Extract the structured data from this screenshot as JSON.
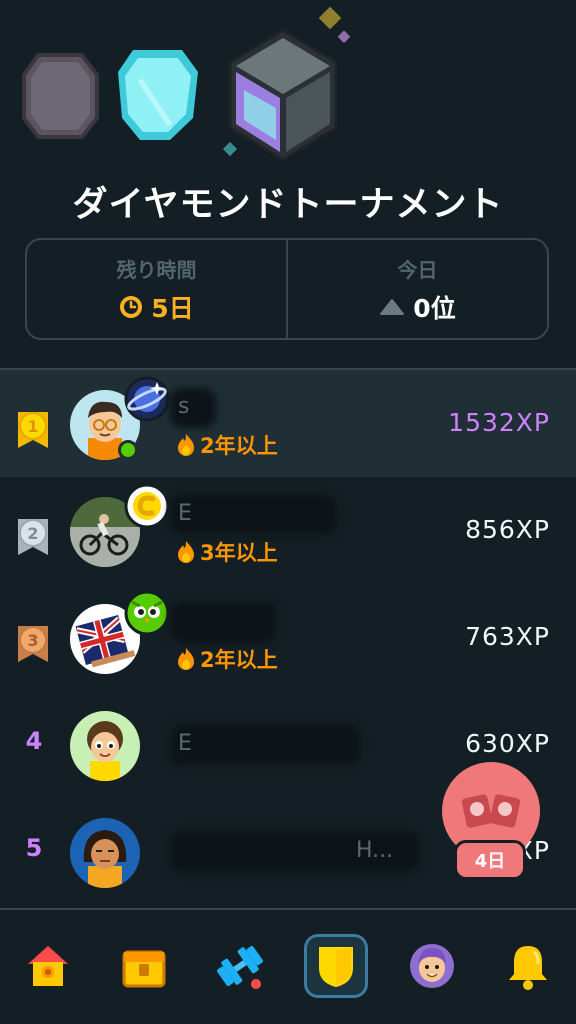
{
  "league": {
    "title": "ダイヤモンドトーナメント",
    "gems": [
      "obsidian-gem-icon",
      "diamond-gem-icon",
      "locked-gem-icon"
    ]
  },
  "stats": {
    "time_left": {
      "label": "残り時間",
      "value": "5日",
      "icon": "clock-icon"
    },
    "today": {
      "label": "今日",
      "value": "0位",
      "icon": "triangle-up-icon"
    }
  },
  "leaderboard": [
    {
      "rank": "1",
      "badge": "gold-medal-icon",
      "name": "s",
      "streak": "2年以上",
      "xp": "1532XP",
      "is_me": true,
      "online": true,
      "achievement": "planet-icon"
    },
    {
      "rank": "2",
      "badge": "silver-medal-icon",
      "name": "E",
      "streak": "3年以上",
      "xp": "856XP",
      "is_me": false,
      "online": false,
      "achievement": "coin-icon"
    },
    {
      "rank": "3",
      "badge": "bronze-medal-icon",
      "name": "",
      "streak": "2年以上",
      "xp": "763XP",
      "is_me": false,
      "online": false,
      "achievement": "duo-owl-icon"
    },
    {
      "rank": "4",
      "badge": "",
      "name": "E",
      "streak": "",
      "xp": "630XP",
      "is_me": false,
      "online": false,
      "achievement": ""
    },
    {
      "rank": "5",
      "badge": "",
      "name": "H...",
      "streak": "",
      "xp": "XP",
      "is_me": false,
      "online": false,
      "achievement": ""
    }
  ],
  "floating": {
    "icon": "chest-icon",
    "badge": "4日"
  },
  "nav": [
    {
      "name": "home",
      "icon": "home-icon",
      "active": false
    },
    {
      "name": "stories",
      "icon": "treasure-chest-icon",
      "active": false
    },
    {
      "name": "practice",
      "icon": "dumbbell-icon",
      "active": false
    },
    {
      "name": "leagues",
      "icon": "shield-icon",
      "active": true
    },
    {
      "name": "profile",
      "icon": "profile-avatar-icon",
      "active": false
    },
    {
      "name": "notifications",
      "icon": "bell-icon",
      "active": false
    }
  ],
  "colors": {
    "background": "#131f24",
    "xp_me": "#ce82ff",
    "streak": "#ff9600",
    "timer": "#ffb020",
    "online": "#58cc02"
  }
}
